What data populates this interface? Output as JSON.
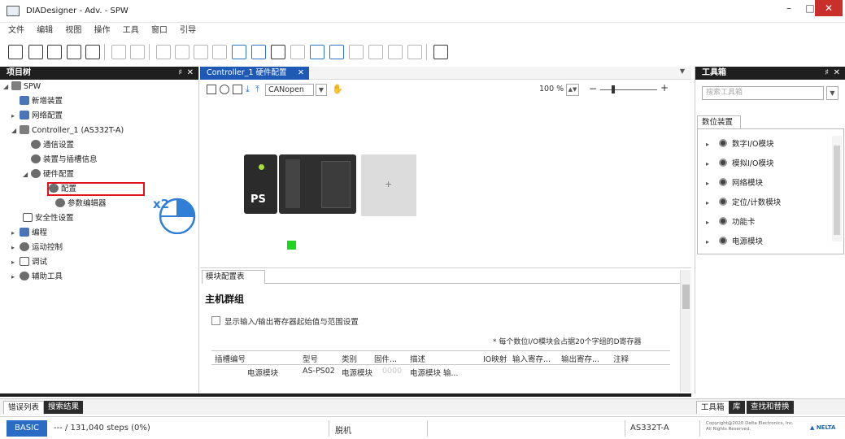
{
  "window": {
    "title": "DIADesigner - Adv. - SPW",
    "min_label": "–",
    "max_label": "□",
    "close_label": "✕"
  },
  "menu": [
    "文件",
    "编辑",
    "视图",
    "操作",
    "工具",
    "窗口",
    "引导"
  ],
  "project_panel": {
    "title": "项目树",
    "pin": "♯",
    "close": "✕",
    "tree": {
      "root": "SPW",
      "new_device": "新增装置",
      "network_config": "网络配置",
      "controller": "Controller_1 (AS332T-A)",
      "comm_settings": "通信设置",
      "device_info": "装置与插槽信息",
      "hw_config": "硬件配置",
      "config": "配置",
      "param_editor": "参数编辑器",
      "safety": "安全性设置",
      "programming": "编程",
      "motion": "运动控制",
      "debug": "调试",
      "aux_tools": "辅助工具"
    },
    "callout": "x2"
  },
  "editor": {
    "tab_label": "Controller_1 硬件配置",
    "tab_close": "✕",
    "protocol": "CANopen",
    "zoom": "100 %",
    "zoom_minus": "−",
    "zoom_plus": "+",
    "ps_label": "PS",
    "slot_plus": "+",
    "sub_tab": "模块配置表",
    "group_title": "主机群组",
    "checkbox_label": "显示输入/输出寄存器起始值与范围设置",
    "note": "* 每个数位I/O模块会占据20个字组的D寄存器",
    "table": {
      "headers": [
        "插槽编号",
        "型号",
        "类别",
        "固件...",
        "描述",
        "IO映射",
        "输入寄存...",
        "输出寄存...",
        "注释"
      ],
      "rows": [
        [
          "",
          "电源模块",
          "AS-PS02",
          "电源模块",
          "0000",
          "电源模块 输...",
          "",
          "",
          ""
        ]
      ]
    }
  },
  "toolbox": {
    "title": "工具箱",
    "pin": "♯",
    "close": "✕",
    "search_placeholder": "搜索工具箱",
    "catalog_tab": "数位装置",
    "items": [
      "数字I/O模块",
      "模拟I/O模块",
      "网络模块",
      "定位/计数模块",
      "功能卡",
      "电源模块"
    ]
  },
  "bottom_tabs": {
    "error_list": "错误列表",
    "search_results": "搜索结果",
    "toolbox": "工具箱",
    "library": "库",
    "find_replace": "查找和替换"
  },
  "statusbar": {
    "mode": "BASIC",
    "steps": "--- / 131,040 steps (0%)",
    "connection": "脱机",
    "model": "AS332T-A",
    "copyright_line1": "Copyright@2020 Delta Electronics, Inc.",
    "copyright_line2": "All Rights Reserved.",
    "logo": "▲ NELTA"
  },
  "colors": {
    "accent_blue": "#1e5ab5",
    "panel_header": "#1f1f1f",
    "highlight_red": "#e0141e",
    "callout_blue": "#2f7fd6",
    "status_green": "#1ed41e",
    "close_red": "#c9302c"
  }
}
